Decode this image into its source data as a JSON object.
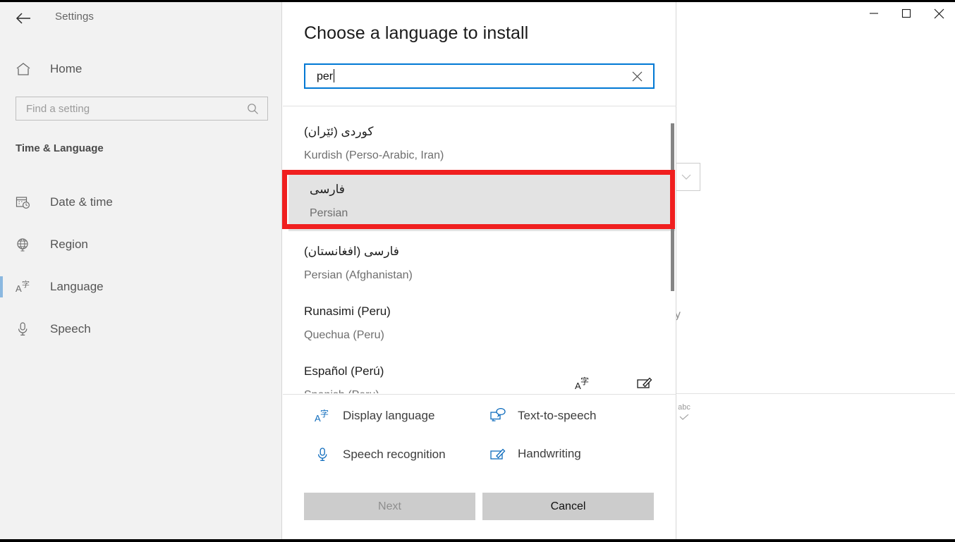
{
  "window": {
    "title": "Settings",
    "controls": {
      "minimize": "minimize-icon",
      "maximize": "maximize-icon",
      "close": "close-icon"
    },
    "back_button": "back-arrow-icon"
  },
  "sidebar": {
    "home": {
      "label": "Home",
      "icon": "home-icon"
    },
    "search": {
      "placeholder": "Find a setting",
      "value": "",
      "icon": "search-icon"
    },
    "section_header": "Time & Language",
    "items": [
      {
        "label": "Date & time",
        "icon": "calendar-clock-icon",
        "selected": false
      },
      {
        "label": "Region",
        "icon": "globe-icon",
        "selected": false
      },
      {
        "label": "Language",
        "icon": "language-icon",
        "selected": true
      },
      {
        "label": "Speech",
        "icon": "microphone-icon",
        "selected": false
      }
    ],
    "accent_color": "#8bb8e0"
  },
  "background": {
    "partial_text": "ey",
    "spellcheck_label": "abc",
    "dropdown_icon": "chevron-down-icon"
  },
  "dialog": {
    "title": "Choose a language to install",
    "search": {
      "value": "per",
      "clear_icon": "close-icon",
      "border_color": "#0078d4"
    },
    "languages": [
      {
        "native": "کوردی (ئێران)",
        "english": "Kurdish (Perso-Arabic, Iran)",
        "rtl": true,
        "highlighted": false,
        "icons": []
      },
      {
        "native": "فارسی",
        "english": "Persian",
        "rtl": true,
        "highlighted": true,
        "icons": []
      },
      {
        "native": "فارسی (افغانستان)",
        "english": "Persian (Afghanistan)",
        "rtl": true,
        "highlighted": false,
        "icons": []
      },
      {
        "native": "Runasimi (Peru)",
        "english": "Quechua (Peru)",
        "rtl": false,
        "highlighted": false,
        "icons": []
      },
      {
        "native": "Español (Perú)",
        "english": "Spanish (Peru)",
        "rtl": false,
        "highlighted": false,
        "icons": [
          "display-language-icon",
          "handwriting-icon"
        ]
      }
    ],
    "features": [
      {
        "label": "Display language",
        "icon": "display-language-icon"
      },
      {
        "label": "Text-to-speech",
        "icon": "text-to-speech-icon"
      },
      {
        "label": "Speech recognition",
        "icon": "microphone-icon"
      },
      {
        "label": "Handwriting",
        "icon": "handwriting-icon"
      }
    ],
    "buttons": {
      "next": {
        "label": "Next",
        "enabled": false
      },
      "cancel": {
        "label": "Cancel",
        "enabled": true
      }
    }
  },
  "annotation": {
    "highlight_color": "#f01f1f",
    "target": "Persian"
  }
}
